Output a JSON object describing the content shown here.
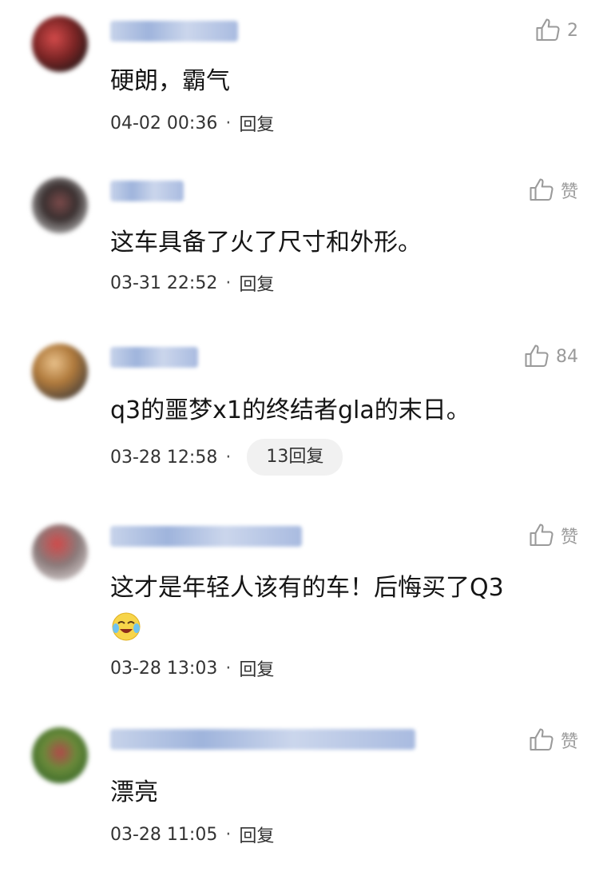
{
  "comments": [
    {
      "username": "",
      "like_label": "2",
      "text": "硬朗，霸气",
      "time": "04-02 00:36",
      "reply_label": "回复"
    },
    {
      "username": "",
      "like_label": "赞",
      "text": "这车具备了火了尺寸和外形。",
      "time": "03-31 22:52",
      "reply_label": "回复"
    },
    {
      "username": "",
      "like_label": "84",
      "text": "q3的噩梦x1的终结者gla的末日。",
      "time": "03-28 12:58",
      "reply_label": "13回复"
    },
    {
      "username": "",
      "like_label": "赞",
      "text": "这才是年轻人该有的车！后悔买了Q3",
      "emoji": "crying-laughing-emoji",
      "time": "03-28 13:03",
      "reply_label": "回复"
    },
    {
      "username": "",
      "like_label": "赞",
      "text": "漂亮",
      "time": "03-28 11:05",
      "reply_label": "回复"
    }
  ],
  "separator": "·",
  "colors": {
    "username": "#6e8ec4",
    "meta": "#333333",
    "like": "#9a9a9a",
    "reply_pill_bg": "#f1f1f1"
  }
}
